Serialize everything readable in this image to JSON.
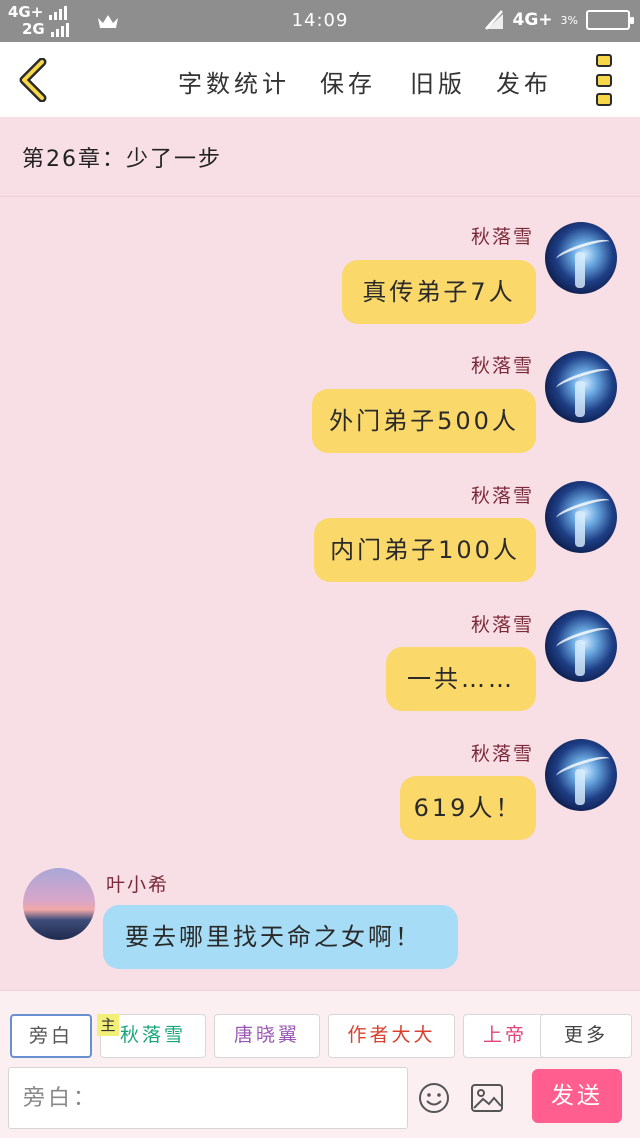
{
  "status_bar": {
    "network_top": "4G+",
    "network_bottom": "2G",
    "time": "14:09",
    "network_right": "4G+",
    "battery_percent": "3%",
    "icons": [
      "signal-icon",
      "crown-icon",
      "mute-icon",
      "battery-icon"
    ]
  },
  "nav": {
    "back_icon": "back-chevron-icon",
    "word_count": "字数统计",
    "save": "保存",
    "old_version": "旧版",
    "publish": "发布",
    "menu_icon": "menu-dots-icon"
  },
  "chapter": {
    "title": "第26章：少了一步"
  },
  "messages": [
    {
      "name": "秋落雪",
      "text": "真传弟子7人",
      "side": "right"
    },
    {
      "name": "秋落雪",
      "text": "外门弟子500人",
      "side": "right"
    },
    {
      "name": "秋落雪",
      "text": "内门弟子100人",
      "side": "right"
    },
    {
      "name": "秋落雪",
      "text": "一共……",
      "side": "right"
    },
    {
      "name": "秋落雪",
      "text": "619人！",
      "side": "right"
    },
    {
      "name": "叶小希",
      "text": "要去哪里找天命之女啊！",
      "side": "left"
    }
  ],
  "characters": {
    "narration": "旁白",
    "master_tag": "主",
    "char1": "秋落雪",
    "char2": "唐晓翼",
    "char3": "作者大大",
    "char4": "上帝",
    "more": "更多"
  },
  "composer": {
    "placeholder": "旁白：",
    "send": "发送",
    "emoji_icon": "emoji-icon",
    "image_icon": "image-icon"
  },
  "colors": {
    "background": "#f8dfe5",
    "bubble_yellow": "#fad86a",
    "bubble_blue": "#a6dcf5",
    "send_button": "#ff5e8f",
    "char1_color": "#1aa67a",
    "char2_color": "#9b59b6",
    "char3_color": "#d9412e",
    "char4_color": "#e0457b"
  }
}
